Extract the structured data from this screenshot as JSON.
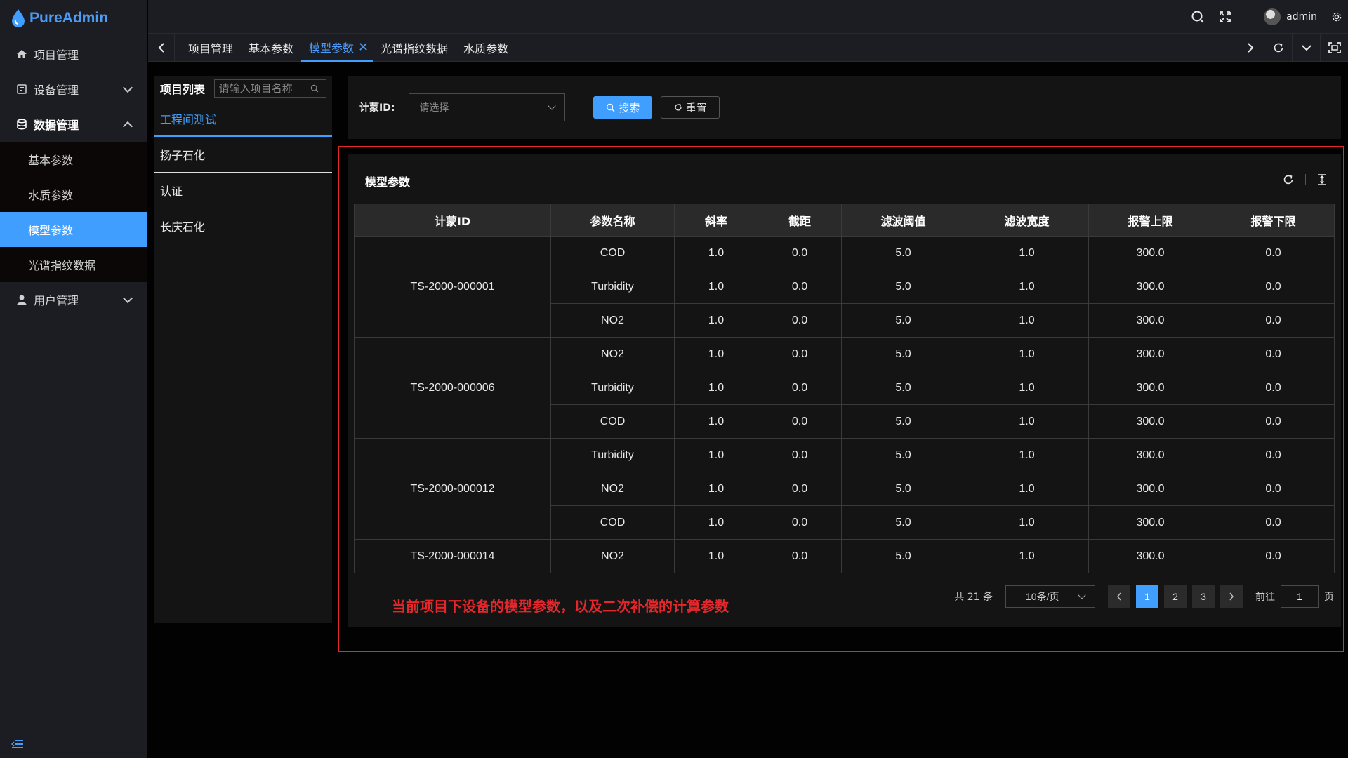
{
  "app": {
    "name": "PureAdmin",
    "brand_color": "#409eff"
  },
  "sidebar": {
    "items": [
      {
        "label": "项目管理",
        "icon": "home-icon"
      },
      {
        "label": "设备管理",
        "icon": "device-icon",
        "expandable": true
      },
      {
        "label": "数据管理",
        "icon": "database-icon",
        "expanded": true,
        "children": [
          "基本参数",
          "水质参数",
          "模型参数",
          "光谱指纹数据"
        ],
        "active_child": "模型参数"
      },
      {
        "label": "用户管理",
        "icon": "user-icon",
        "expandable": true
      }
    ]
  },
  "header": {
    "username": "admin"
  },
  "tabs": [
    {
      "label": "项目管理"
    },
    {
      "label": "基本参数"
    },
    {
      "label": "模型参数",
      "active": true
    },
    {
      "label": "光谱指纹数据"
    },
    {
      "label": "水质参数"
    }
  ],
  "project_panel": {
    "title": "项目列表",
    "search_placeholder": "请输入项目名称",
    "items": [
      "工程间测试",
      "扬子石化",
      "认证",
      "长庆石化"
    ],
    "active": "工程间测试"
  },
  "search": {
    "label": "计蒙ID:",
    "select_placeholder": "请选择",
    "search_button": "搜索",
    "reset_button": "重置"
  },
  "table": {
    "title": "模型参数",
    "columns": [
      "计蒙ID",
      "参数名称",
      "斜率",
      "截距",
      "滤波阈值",
      "滤波宽度",
      "报警上限",
      "报警下限"
    ],
    "groups": [
      {
        "id": "TS-2000-000001",
        "rows": [
          [
            "COD",
            "1.0",
            "0.0",
            "5.0",
            "1.0",
            "300.0",
            "0.0"
          ],
          [
            "Turbidity",
            "1.0",
            "0.0",
            "5.0",
            "1.0",
            "300.0",
            "0.0"
          ],
          [
            "NO2",
            "1.0",
            "0.0",
            "5.0",
            "1.0",
            "300.0",
            "0.0"
          ]
        ]
      },
      {
        "id": "TS-2000-000006",
        "rows": [
          [
            "NO2",
            "1.0",
            "0.0",
            "5.0",
            "1.0",
            "300.0",
            "0.0"
          ],
          [
            "Turbidity",
            "1.0",
            "0.0",
            "5.0",
            "1.0",
            "300.0",
            "0.0"
          ],
          [
            "COD",
            "1.0",
            "0.0",
            "5.0",
            "1.0",
            "300.0",
            "0.0"
          ]
        ]
      },
      {
        "id": "TS-2000-000012",
        "rows": [
          [
            "Turbidity",
            "1.0",
            "0.0",
            "5.0",
            "1.0",
            "300.0",
            "0.0"
          ],
          [
            "NO2",
            "1.0",
            "0.0",
            "5.0",
            "1.0",
            "300.0",
            "0.0"
          ],
          [
            "COD",
            "1.0",
            "0.0",
            "5.0",
            "1.0",
            "300.0",
            "0.0"
          ]
        ]
      },
      {
        "id": "TS-2000-000014",
        "rows": [
          [
            "NO2",
            "1.0",
            "0.0",
            "5.0",
            "1.0",
            "300.0",
            "0.0"
          ]
        ]
      }
    ]
  },
  "annotation": {
    "text": "当前项目下设备的模型参数，以及二次补偿的计算参数",
    "color": "#e5262a"
  },
  "pagination": {
    "total": "共 21 条",
    "page_size": "10条/页",
    "pages": [
      "1",
      "2",
      "3"
    ],
    "current": "1",
    "jump_label": "前往",
    "jump_value": "1",
    "page_suffix": "页"
  }
}
